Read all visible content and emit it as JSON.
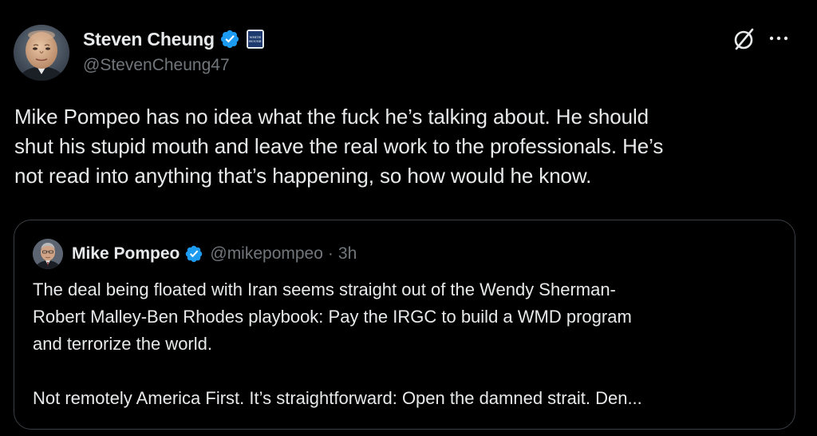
{
  "tweet": {
    "author": {
      "name": "Steven Cheung",
      "handle": "@StevenCheung47",
      "verified": true,
      "affiliate_badge_text": "WHITE HOUSE"
    },
    "text": "Mike Pompeo has no idea what the fuck he’s talking about. He should\nshut his stupid mouth and leave the real work to the professionals. He’s\nnot read into anything that’s happening, so how would he know.",
    "actions": {
      "grok_icon": "grok-icon",
      "more_icon": "more-options-icon"
    }
  },
  "quoted_tweet": {
    "author": {
      "name": "Mike Pompeo",
      "handle": "@mikepompeo",
      "verified": true
    },
    "separator": "·",
    "time": "3h",
    "text": "The deal being floated with Iran seems straight out of the Wendy Sherman-\nRobert Malley-Ben Rhodes playbook: Pay the IRGC to build a WMD program\nand terrorize the world.\n\nNot remotely America First. It’s straightforward: Open the damned strait. Den..."
  },
  "colors": {
    "background": "#000000",
    "text_primary": "#e7e9ea",
    "text_secondary": "#71767b",
    "verified_blue": "#1d9bf0",
    "card_border": "#3a3f44"
  }
}
